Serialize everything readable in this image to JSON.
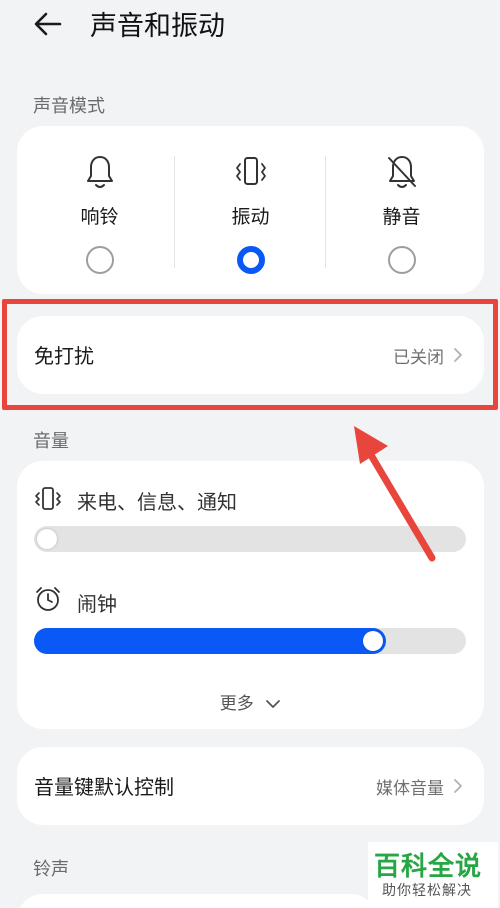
{
  "header": {
    "title": "声音和振动"
  },
  "sound_mode": {
    "section_label": "声音模式",
    "options": [
      {
        "label": "响铃",
        "icon": "bell-icon",
        "selected": false
      },
      {
        "label": "振动",
        "icon": "vibrate-icon",
        "selected": true
      },
      {
        "label": "静音",
        "icon": "bell-off-icon",
        "selected": false
      }
    ]
  },
  "dnd": {
    "title": "免打扰",
    "value": "已关闭"
  },
  "volume": {
    "section_label": "音量",
    "sliders": [
      {
        "label": "来电、信息、通知",
        "icon": "vibrate-icon",
        "level": 0.0
      },
      {
        "label": "闹钟",
        "icon": "alarm-clock-icon",
        "level": 0.81
      }
    ],
    "more_label": "更多"
  },
  "volume_key": {
    "title": "音量键默认控制",
    "value": "媒体音量"
  },
  "ringtone": {
    "section_label": "铃声"
  },
  "watermark": {
    "title": "百科全说",
    "subtitle": "助你轻松解决"
  },
  "colors": {
    "accent": "#0a59f7",
    "highlight": "#e8453c",
    "watermark": "#27a645",
    "background": "#f1f3f5"
  }
}
